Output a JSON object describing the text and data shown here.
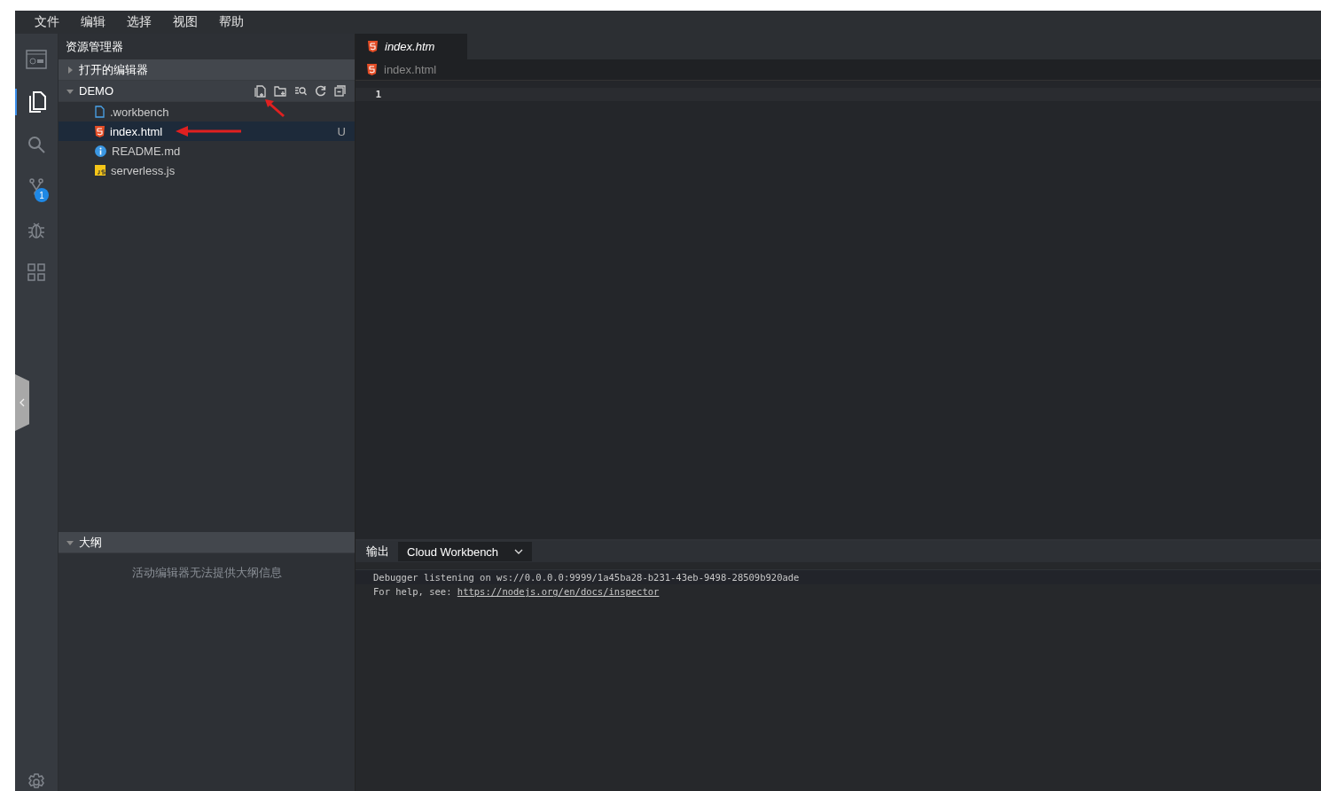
{
  "menu": [
    "文件",
    "编辑",
    "选择",
    "视图",
    "帮助"
  ],
  "activity_bar": [
    {
      "kind": "workbench",
      "selected": false
    },
    {
      "kind": "explorer",
      "selected": true
    },
    {
      "kind": "search",
      "selected": false
    },
    {
      "kind": "git",
      "selected": false,
      "badge": "1"
    },
    {
      "kind": "debug",
      "selected": false
    },
    {
      "kind": "extensions",
      "selected": false
    }
  ],
  "sidebar": {
    "title": "资源管理器",
    "open_editors": {
      "label": "打开的编辑器",
      "expanded": false
    },
    "project": {
      "label": "DEMO",
      "expanded": true,
      "tools": [
        {
          "kind": "new-file"
        },
        {
          "kind": "new-folder"
        },
        {
          "kind": "find"
        },
        {
          "kind": "refresh"
        },
        {
          "kind": "collapse"
        }
      ],
      "files": [
        {
          "name": ".workbench",
          "kind": "file",
          "selected": false
        },
        {
          "name": "index.html",
          "kind": "html",
          "selected": true,
          "status": "U"
        },
        {
          "name": "README.md",
          "kind": "info",
          "selected": false
        },
        {
          "name": "serverless.js",
          "kind": "js",
          "selected": false
        }
      ]
    },
    "outline": {
      "label": "大纲",
      "expanded": true,
      "message": "活动编辑器无法提供大纲信息"
    }
  },
  "editor": {
    "tabs": [
      {
        "label": "index.htm",
        "kind": "html",
        "selected": true
      }
    ],
    "breadcrumb": "index.html",
    "line_numbers": [
      "1"
    ]
  },
  "panel": {
    "tab": "输出",
    "channel": "Cloud Workbench",
    "lines": [
      {
        "text": "Debugger listening on ws://0.0.0.0:9999/1a45ba28-b231-43eb-9498-28509b920ade"
      },
      {
        "text": "For help, see: ",
        "link": "https://nodejs.org/en/docs/inspector"
      }
    ]
  }
}
